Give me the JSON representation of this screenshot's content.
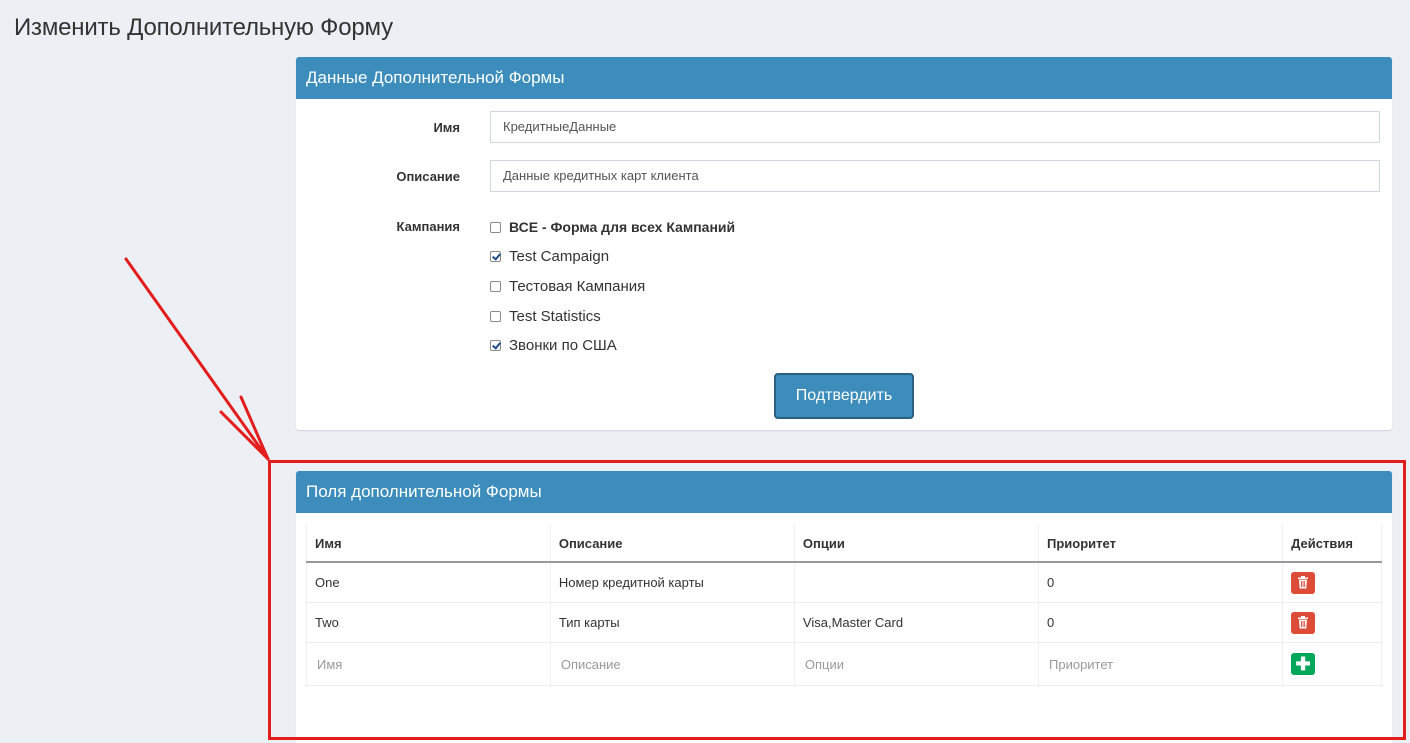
{
  "page": {
    "title": "Изменить Дополнительную Форму"
  },
  "form_panel": {
    "title": "Данные Дополнительной Формы",
    "name_label": "Имя",
    "name_value": "КредитныеДанные",
    "description_label": "Описание",
    "description_value": "Данные кредитных карт клиента",
    "campaign_label": "Кампания",
    "campaigns": [
      {
        "label": "ВСЕ - Форма для всех Кампаний",
        "checked": false
      },
      {
        "label": "Test Campaign",
        "checked": true
      },
      {
        "label": "Тестовая Кампания",
        "checked": false
      },
      {
        "label": "Test Statistics",
        "checked": false
      },
      {
        "label": "Звонки по США",
        "checked": true
      }
    ],
    "submit_label": "Подтвердить"
  },
  "fields_panel": {
    "title": "Поля дополнительной Формы",
    "columns": [
      "Имя",
      "Описание",
      "Опции",
      "Приоритет",
      "Действия"
    ],
    "rows": [
      {
        "name": "One",
        "description": "Номер кредитной карты",
        "options": "",
        "priority": "0"
      },
      {
        "name": "Two",
        "description": "Тип карты",
        "options": "Visa,Master Card",
        "priority": "0"
      }
    ],
    "new_row_placeholders": {
      "name": "Имя",
      "description": "Описание",
      "options": "Опции",
      "priority": "Приоритет"
    }
  },
  "colors": {
    "panel_header": "#3c8dbc",
    "delete_button": "#dd4b39",
    "add_button": "#00a65a",
    "annotation": "#e31c1c"
  },
  "icons": {
    "delete": "trash-icon",
    "add": "plus-icon",
    "annotation_arrow": "arrow-icon"
  }
}
